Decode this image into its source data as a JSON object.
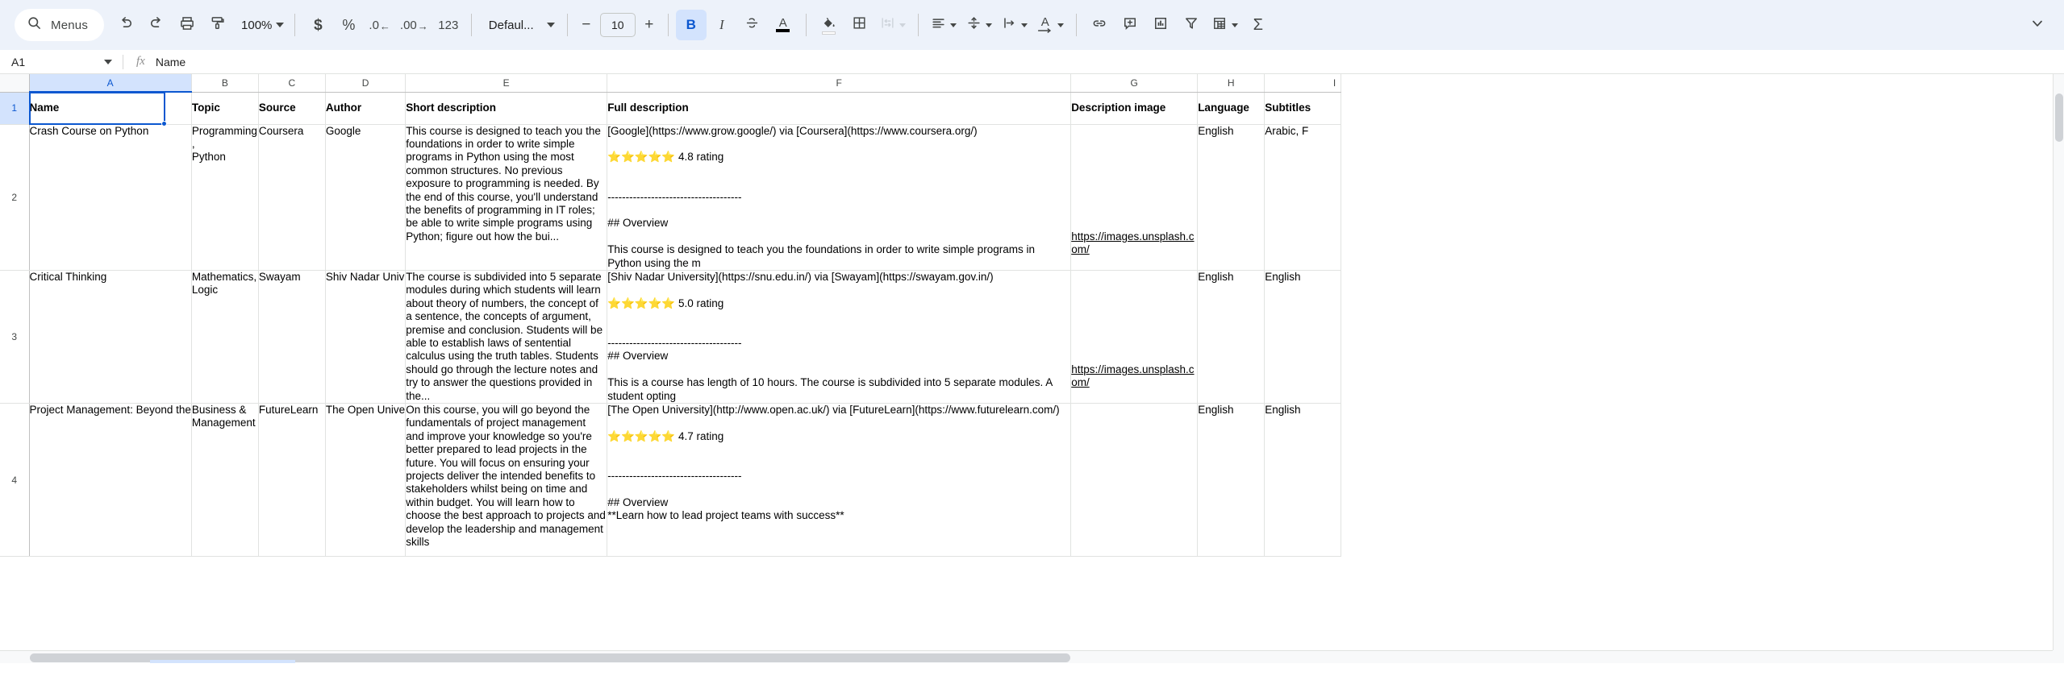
{
  "toolbar": {
    "search_label": "Menus",
    "search_icon": "search-icon",
    "undo_icon": "undo-icon",
    "redo_icon": "redo-icon",
    "print_icon": "print-icon",
    "paint_format_icon": "paint-format-icon",
    "zoom_value": "100%",
    "currency_label": "$",
    "percent_label": "%",
    "decrease_decimal_label": ".0",
    "increase_decimal_label": ".00",
    "more_formats_label": "123",
    "font_family": "Defaul...",
    "decrease_font_label": "−",
    "font_size": "10",
    "increase_font_label": "+",
    "bold_label": "B",
    "italic_label": "I",
    "strikethrough_icon": "strikethrough-icon",
    "text_color_label": "A",
    "fill_color_icon": "fill-color-icon",
    "borders_icon": "borders-icon",
    "merge_cells_icon": "merge-cells-icon",
    "horizontal_align_icon": "horizontal-align-icon",
    "vertical_align_icon": "vertical-align-icon",
    "text_wrapping_icon": "text-wrapping-icon",
    "text_rotation_label": "A",
    "insert_link_icon": "insert-link-icon",
    "insert_comment_icon": "insert-comment-icon",
    "insert_chart_icon": "insert-chart-icon",
    "create_filter_icon": "create-filter-icon",
    "functions_label": "Σ",
    "pivot_icon": "pivot-table-icon",
    "collapse_icon": "chevron-down-icon"
  },
  "formula_bar": {
    "name_box_value": "A1",
    "fx_label": "fx",
    "formula_value": "Name"
  },
  "grid": {
    "column_headers": [
      "A",
      "B",
      "C",
      "D",
      "E",
      "F",
      "G",
      "H",
      "I"
    ],
    "selected_column": "A",
    "row_headers": [
      "1",
      "2",
      "3",
      "4"
    ],
    "selected_row": "1",
    "rows": [
      {
        "n": "1",
        "cells": [
          "Name",
          "Topic",
          "Source",
          "Author",
          "Short description",
          "Full description",
          "Description image",
          "Language",
          "Subtitles"
        ]
      },
      {
        "n": "2",
        "cells": [
          "Crash Course on Python",
          "Programming,\nPython",
          "Coursera",
          "Google",
          "This course is designed to teach you the foundations in order to write simple programs in Python using the most common structures. No previous exposure to programming is needed. By the end of this course, you'll understand the benefits of programming in IT roles; be able to write simple programs using Python; figure out how the bui...",
          "[Google](https://www.grow.google/) via [Coursera](https://www.coursera.org/)\n\n⭐⭐⭐⭐⭐ 4.8 rating\n\n\n-------------------------------------\n\n## Overview\n\nThis course is designed to teach you the foundations in order to write simple programs in Python using the m",
          "https://images.unsplash.com/",
          "English",
          "Arabic, F"
        ]
      },
      {
        "n": "3",
        "cells": [
          "Critical Thinking",
          "Mathematics,\nLogic",
          "Swayam",
          "Shiv Nadar Univ",
          "The course is subdivided into 5 separate modules during which students will learn about theory of numbers, the concept of a sentence, the concepts of argument, premise and conclusion. Students will be able to establish laws of sentential calculus using the truth tables. Students should go through the lecture notes and try to answer the questions provided in the...",
          "[Shiv Nadar University](https://snu.edu.in/) via [Swayam](https://swayam.gov.in/)\n\n⭐⭐⭐⭐⭐ 5.0 rating\n\n\n-------------------------------------\n## Overview\n\nThis is a course has length of 10 hours. The course is subdivided into 5 separate modules. A student opting",
          "https://images.unsplash.com/",
          "English",
          "English"
        ]
      },
      {
        "n": "4",
        "cells": [
          "Project Management: Beyond the",
          "Business &\nManagement",
          "FutureLearn",
          "The Open Unive",
          "On this course, you will go beyond the fundamentals of project management and improve your knowledge so you're better prepared to lead projects in the future. You will focus on ensuring your projects deliver the intended benefits to stakeholders whilst being on time and within budget. You will learn how to choose the best approach to projects and develop the leadership and management skills",
          "[The Open University](http://www.open.ac.uk/) via [FutureLearn](https://www.futurelearn.com/)\n\n⭐⭐⭐⭐⭐ 4.7 rating\n\n\n-------------------------------------\n\n## Overview\n**Learn how to lead project teams with success**",
          "",
          "English",
          "English"
        ]
      }
    ]
  },
  "colors": {
    "accent": "#0b57d0",
    "toolbar_bg": "#edf2fa",
    "selection_bg": "#d3e3fd",
    "grid_line": "#e1e3e1"
  }
}
